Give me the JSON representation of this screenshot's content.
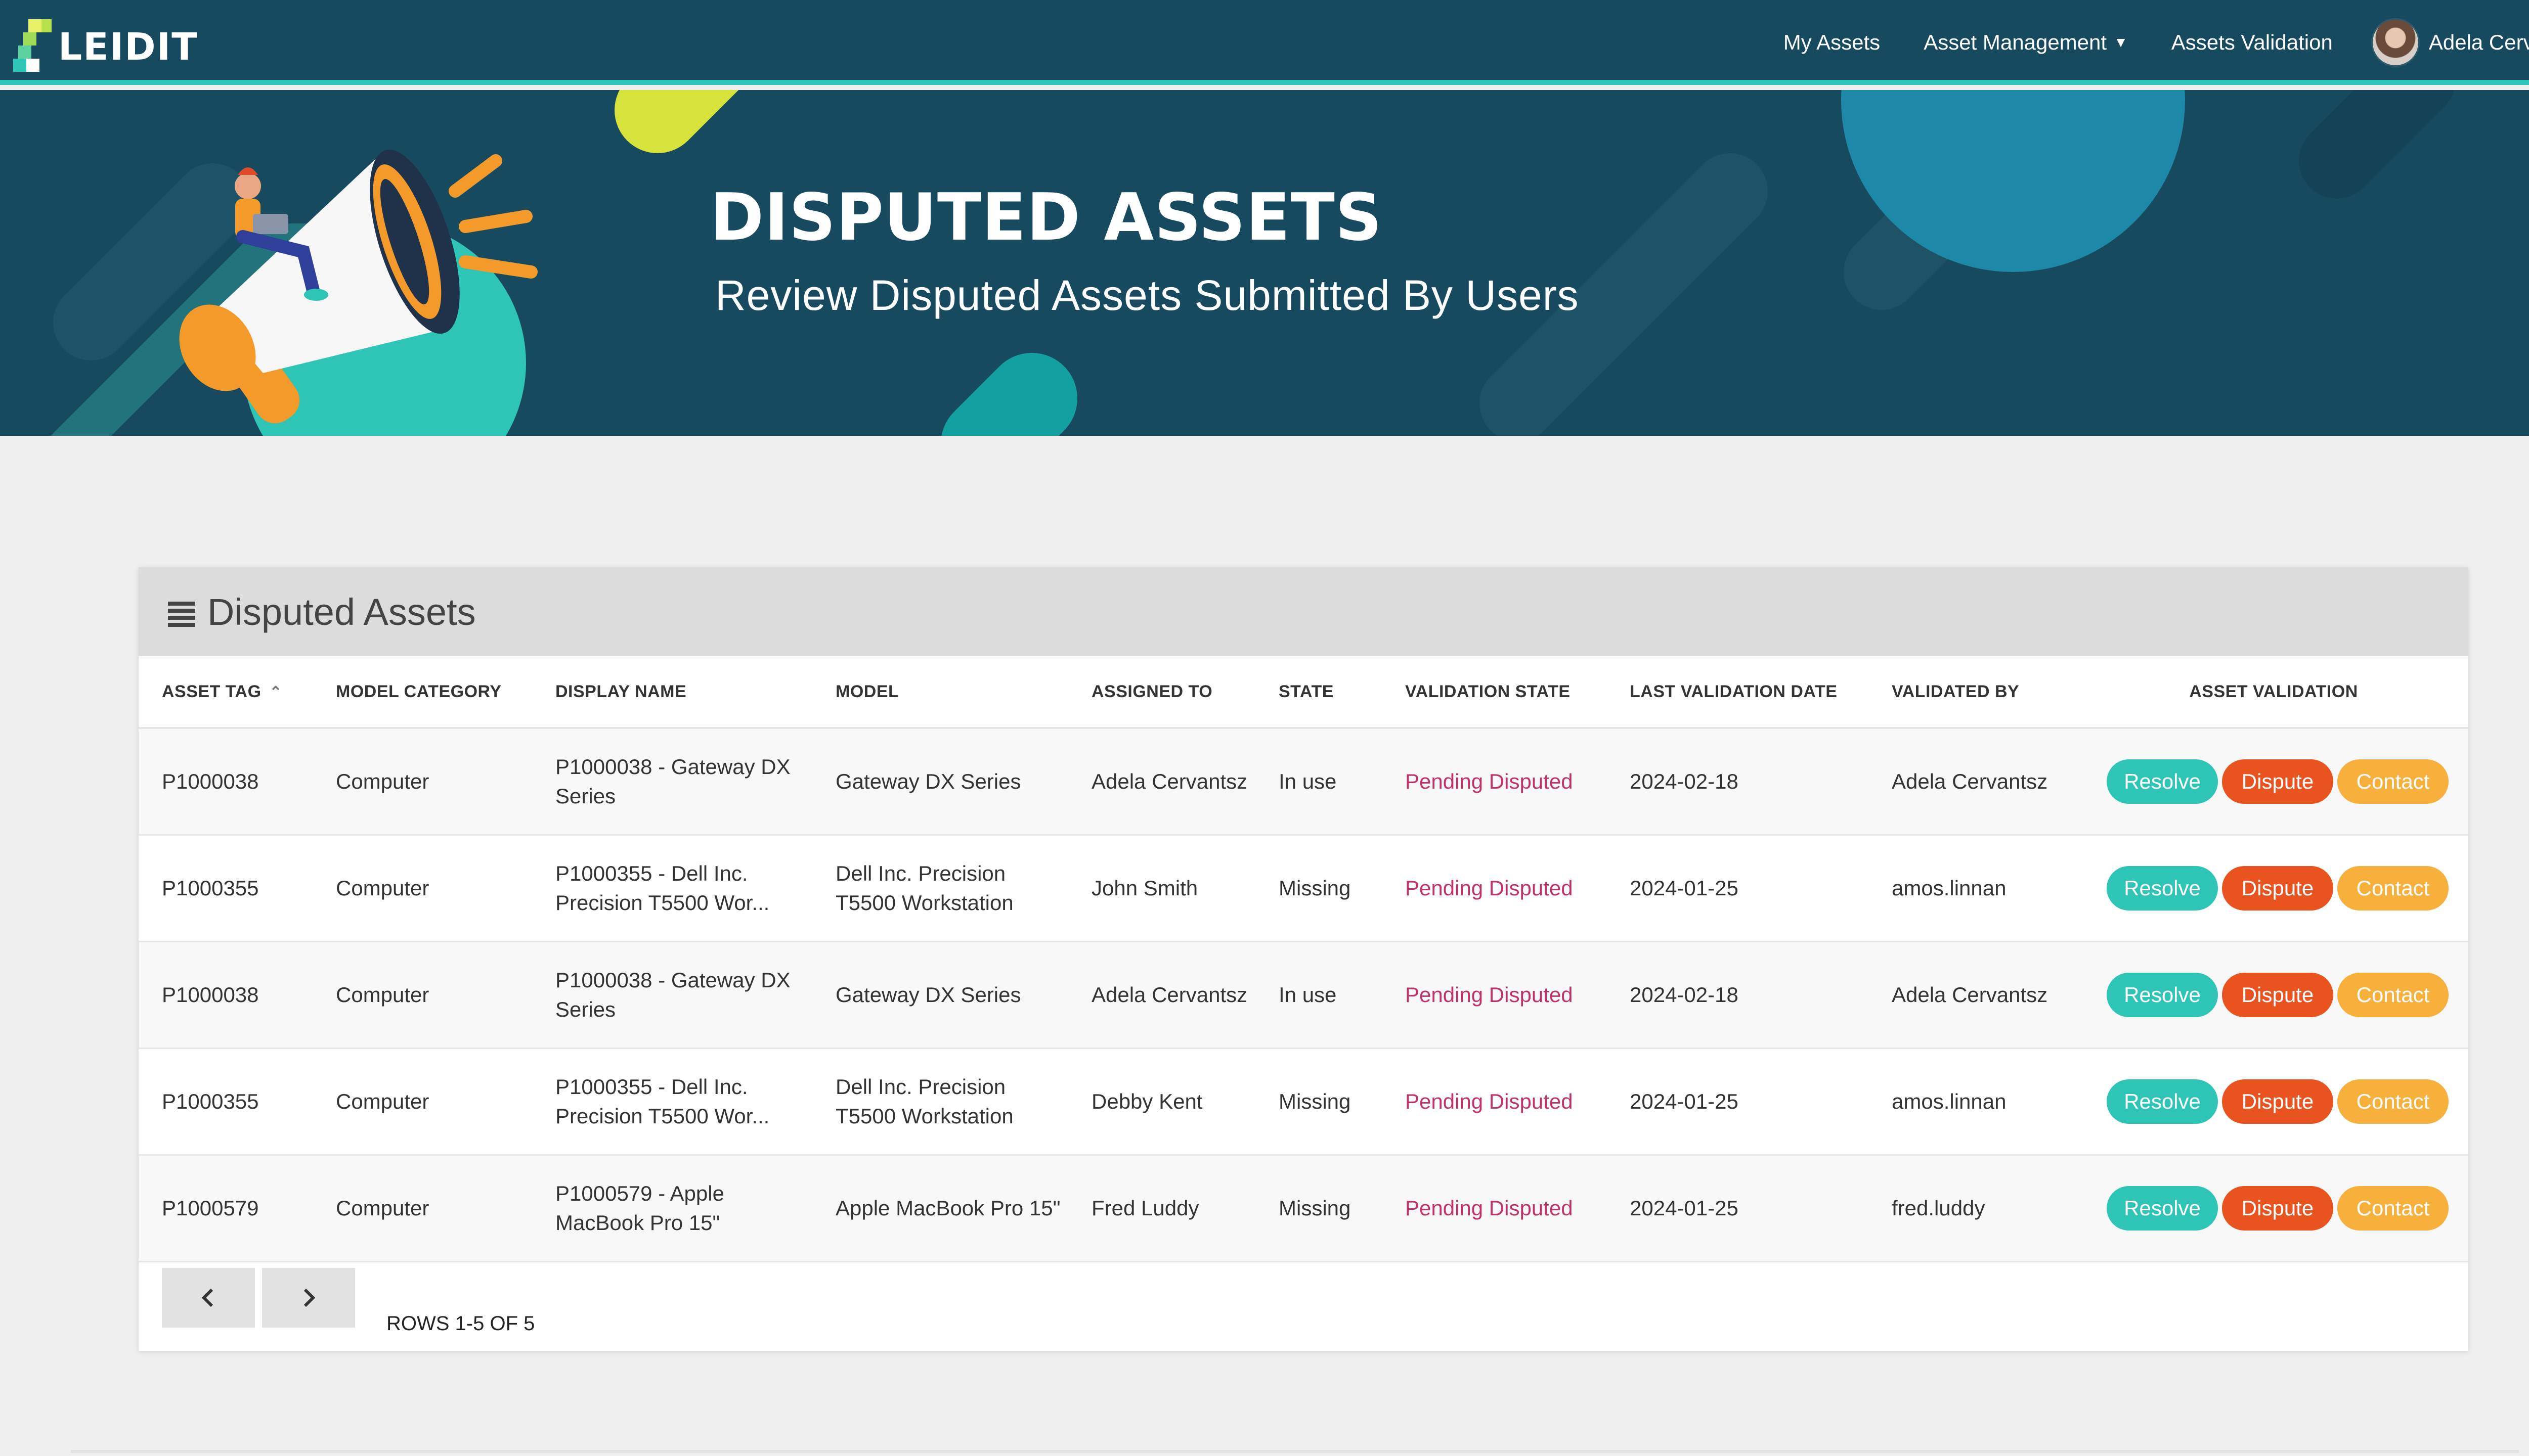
{
  "brand": {
    "name": "LEIDIT"
  },
  "nav": {
    "my_assets": "My Assets",
    "asset_management": "Asset Management",
    "assets_validation": "Assets Validation",
    "user_name": "Adela Cervantsz"
  },
  "banner": {
    "title": "DISPUTED ASSETS",
    "subtitle": "Review Disputed Assets Submitted By Users"
  },
  "card": {
    "title": "Disputed Assets",
    "columns": {
      "asset_tag": "ASSET TAG",
      "model_category": "MODEL CATEGORY",
      "display_name": "DISPLAY NAME",
      "model": "MODEL",
      "assigned_to": "ASSIGNED TO",
      "state": "STATE",
      "validation_state": "VALIDATION STATE",
      "last_validation_date": "LAST VALIDATION DATE",
      "validated_by": "VALIDATED BY",
      "asset_validation": "ASSET VALIDATION"
    },
    "rows": [
      {
        "asset_tag": "P1000038",
        "model_category": "Computer",
        "display_name": "P1000038 - Gateway DX Series",
        "model": "Gateway DX Series",
        "assigned_to": "Adela Cervantsz",
        "state": "In use",
        "validation_state": "Pending Disputed",
        "last_validation_date": "2024-02-18",
        "validated_by": "Adela Cervantsz"
      },
      {
        "asset_tag": "P1000355",
        "model_category": "Computer",
        "display_name": "P1000355 - Dell Inc. Precision T5500 Wor...",
        "model": "Dell Inc. Precision T5500 Workstation",
        "assigned_to": "John Smith",
        "state": "Missing",
        "validation_state": "Pending Disputed",
        "last_validation_date": "2024-01-25",
        "validated_by": "amos.linnan"
      },
      {
        "asset_tag": "P1000038",
        "model_category": "Computer",
        "display_name": "P1000038 - Gateway DX Series",
        "model": "Gateway DX Series",
        "assigned_to": "Adela Cervantsz",
        "state": "In use",
        "validation_state": "Pending Disputed",
        "last_validation_date": "2024-02-18",
        "validated_by": "Adela Cervantsz"
      },
      {
        "asset_tag": "P1000355",
        "model_category": "Computer",
        "display_name": "P1000355 - Dell Inc. Precision T5500 Wor...",
        "model": "Dell Inc. Precision T5500 Workstation",
        "assigned_to": "Debby Kent",
        "state": "Missing",
        "validation_state": "Pending Disputed",
        "last_validation_date": "2024-01-25",
        "validated_by": "amos.linnan"
      },
      {
        "asset_tag": "P1000579",
        "model_category": "Computer",
        "display_name": "P1000579 - Apple MacBook Pro 15\"",
        "model": "Apple MacBook Pro 15\"",
        "assigned_to": "Fred Luddy",
        "state": "Missing",
        "validation_state": "Pending Disputed",
        "last_validation_date": "2024-01-25",
        "validated_by": "fred.luddy"
      }
    ],
    "actions": {
      "resolve": "Resolve",
      "dispute": "Dispute",
      "contact": "Contact"
    },
    "pagination": {
      "rows_info": "ROWS 1-5 OF 5"
    }
  },
  "colors": {
    "nav_bg": "#184a5f",
    "accent_teal": "#2ec4b6",
    "dispute_orange": "#e8531f",
    "contact_yellow": "#f7b03c",
    "pending_pink": "#c2316a"
  },
  "icons": [
    "list-icon",
    "sort-ascending-icon",
    "chevron-left-icon",
    "chevron-right-icon",
    "caret-down-icon",
    "megaphone-illustration"
  ]
}
